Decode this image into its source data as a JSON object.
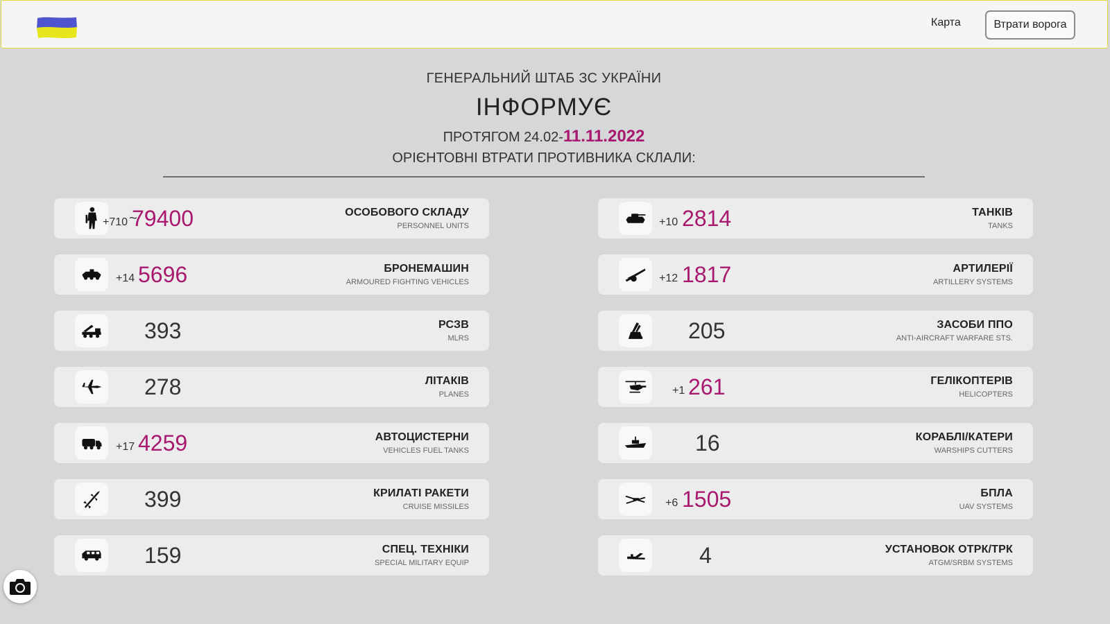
{
  "header": {
    "map_label": "Карта",
    "losses_button": "Втрати ворога",
    "flag_colors": [
      "#4e55cf",
      "#e7e51b"
    ]
  },
  "heading": {
    "staff": "ГЕНЕРАЛЬНИЙ ШТАБ ЗС УКРАЇНИ",
    "informs": "ІНФОРМУЄ",
    "period_prefix": "ПРОТЯГОМ 24.02-",
    "period_date": "11.11.2022",
    "subtitle": "ОРІЄНТОВНІ ВТРАТИ ПРОТИВНИКА СКЛАЛИ:"
  },
  "accent_color": "#a8186f",
  "left": [
    {
      "icon": "soldier-icon",
      "delta": "+710",
      "value": "79400",
      "label": "ОСОБОВОГО СКЛАДУ",
      "sub": "PERSONNEL UNITS",
      "approx": "~"
    },
    {
      "icon": "armored-vehicle-icon",
      "delta": "+14",
      "value": "5696",
      "label": "БРОНЕМАШИН",
      "sub": "ARMOURED FIGHTING VEHICLES"
    },
    {
      "icon": "mlrs-icon",
      "delta": "",
      "value": "393",
      "label": "РСЗВ",
      "sub": "MLRS"
    },
    {
      "icon": "plane-icon",
      "delta": "",
      "value": "278",
      "label": "ЛІТАКІВ",
      "sub": "PLANES"
    },
    {
      "icon": "fuel-truck-icon",
      "delta": "+17",
      "value": "4259",
      "label": "АВТОЦИСТЕРНИ",
      "sub": "VEHICLES FUEL TANKS"
    },
    {
      "icon": "cruise-missile-icon",
      "delta": "",
      "value": "399",
      "label": "КРИЛАТІ РАКЕТИ",
      "sub": "CRUISE MISSILES"
    },
    {
      "icon": "special-vehicle-icon",
      "delta": "",
      "value": "159",
      "label": "СПЕЦ. ТЕХНІКИ",
      "sub": "SPECIAL MILITARY EQUIP"
    }
  ],
  "right": [
    {
      "icon": "tank-icon",
      "delta": "+10",
      "value": "2814",
      "label": "ТАНКІВ",
      "sub": "TANKS"
    },
    {
      "icon": "artillery-icon",
      "delta": "+12",
      "value": "1817",
      "label": "АРТИЛЕРІЇ",
      "sub": "ARTILLERY SYSTEMS"
    },
    {
      "icon": "air-defense-icon",
      "delta": "",
      "value": "205",
      "label": "ЗАСОБИ ППО",
      "sub": "ANTI-AIRCRAFT WARFARE STS."
    },
    {
      "icon": "helicopter-icon",
      "delta": "+1",
      "value": "261",
      "label": "ГЕЛІКОПТЕРІВ",
      "sub": "HELICOPTERS"
    },
    {
      "icon": "warship-icon",
      "delta": "",
      "value": "16",
      "label": "КОРАБЛІ/КАТЕРИ",
      "sub": "WARSHIPS CUTTERS"
    },
    {
      "icon": "drone-icon",
      "delta": "+6",
      "value": "1505",
      "label": "БПЛА",
      "sub": "UAV SYSTEMS"
    },
    {
      "icon": "srbm-launcher-icon",
      "delta": "",
      "value": "4",
      "label": "УСТАНОВОК ОТРК/ТРК",
      "sub": "ATGM/SRBM SYSTEMS"
    }
  ],
  "camera_icon": "camera-icon"
}
